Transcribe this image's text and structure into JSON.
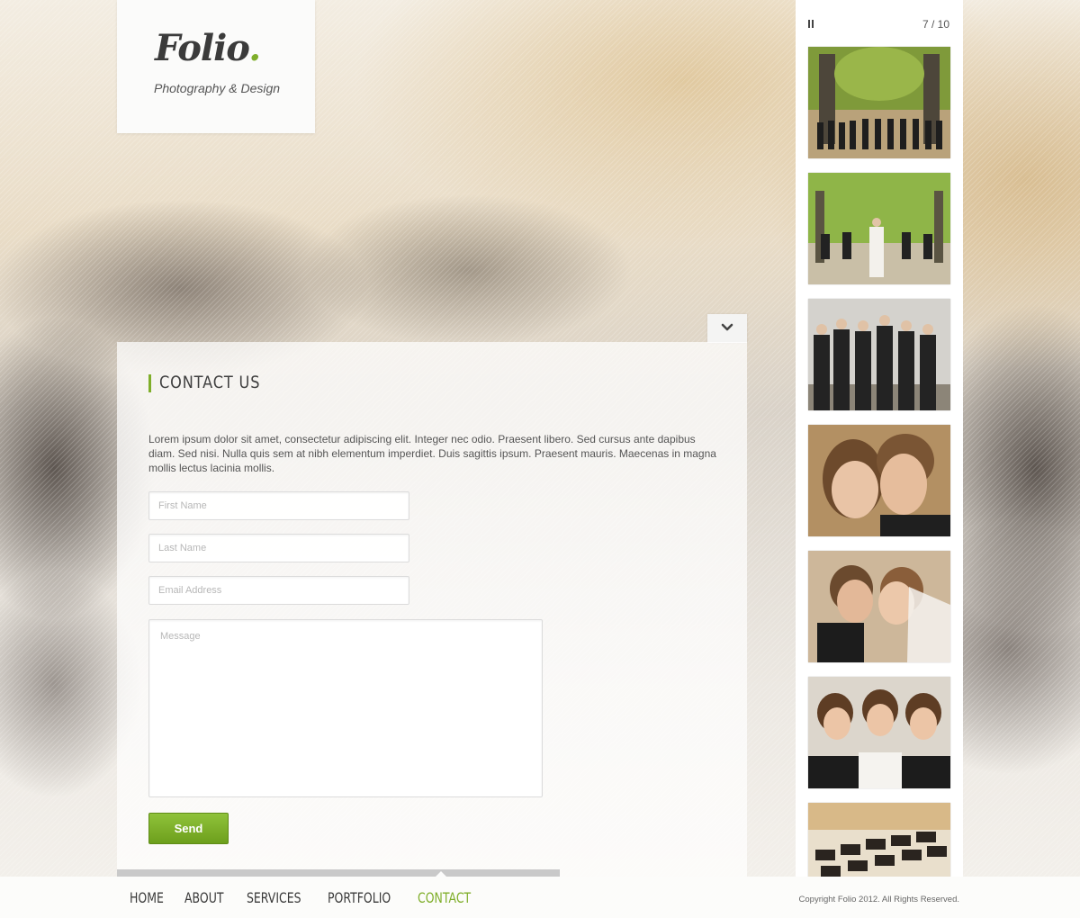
{
  "brand": {
    "name": "Folio",
    "dot": ".",
    "tagline": "Photography & Design",
    "accent_color": "#7fae2a"
  },
  "contact": {
    "heading": "CONTACT US",
    "intro": "Lorem ipsum dolor sit amet, consectetur adipiscing elit. Integer nec odio. Praesent libero. Sed cursus ante dapibus diam. Sed nisi. Nulla quis sem at nibh elementum imperdiet. Duis sagittis ipsum. Praesent mauris. Maecenas in magna mollis lectus lacinia mollis.",
    "fields": {
      "first_name_placeholder": "First Name",
      "last_name_placeholder": "Last Name",
      "email_placeholder": "Email Address",
      "message_placeholder": "Message"
    },
    "send_label": "Send",
    "collapse_icon": "chevron-down-icon"
  },
  "gallery": {
    "counter": "7 / 10",
    "pause_icon": "pause-icon",
    "progress": 0.7
  },
  "nav": {
    "items": [
      {
        "label": "HOME"
      },
      {
        "label": "ABOUT"
      },
      {
        "label": "SERVICES"
      },
      {
        "label": "PORTFOLIO"
      },
      {
        "label": "CONTACT",
        "active": true
      }
    ]
  },
  "footer": {
    "copyright": "Copyright Folio 2012. All Rights Reserved."
  }
}
